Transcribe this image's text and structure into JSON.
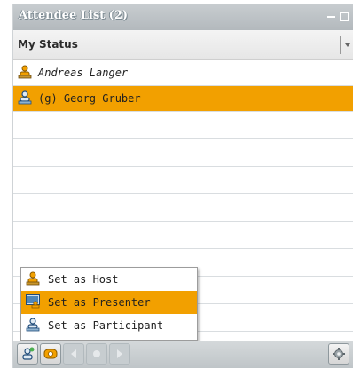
{
  "panel": {
    "title": "Attendee List (2)",
    "status_label": "My Status"
  },
  "attendees": [
    {
      "name": "Andreas Langer",
      "role_icon": "host-icon",
      "selected": false
    },
    {
      "name": "(g) Georg Gruber",
      "role_icon": "participant-icon",
      "selected": true
    }
  ],
  "context_menu": {
    "items": [
      {
        "label": "Set as Host",
        "icon": "host-icon",
        "active": false
      },
      {
        "label": "Set as Presenter",
        "icon": "presenter-icon",
        "active": true
      },
      {
        "label": "Set as Participant",
        "icon": "participant-icon",
        "active": false
      }
    ]
  },
  "toolbar": {
    "buttons": [
      "change-role-icon",
      "phone-icon",
      "prev-icon",
      "record-icon",
      "next-icon"
    ],
    "right_button": "gear-icon"
  },
  "colors": {
    "highlight": "#f2a000",
    "titlebar": "#b3b9bd"
  }
}
